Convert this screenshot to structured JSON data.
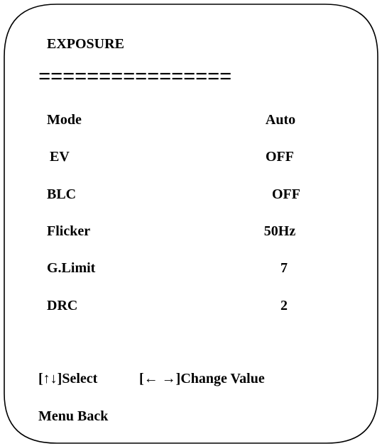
{
  "menu": {
    "title": "EXPOSURE",
    "divider": "================",
    "items": [
      {
        "label": "Mode",
        "value": "Auto"
      },
      {
        "label": "EV",
        "value": "OFF"
      },
      {
        "label": "BLC",
        "value": "OFF"
      },
      {
        "label": "Flicker",
        "value": "50Hz"
      },
      {
        "label": "G.Limit",
        "value": "7"
      },
      {
        "label": "DRC",
        "value": "2"
      }
    ]
  },
  "footer": {
    "select_hint": "[↑↓]Select",
    "change_hint": "[← →]Change Value",
    "back_hint": "Menu Back"
  }
}
